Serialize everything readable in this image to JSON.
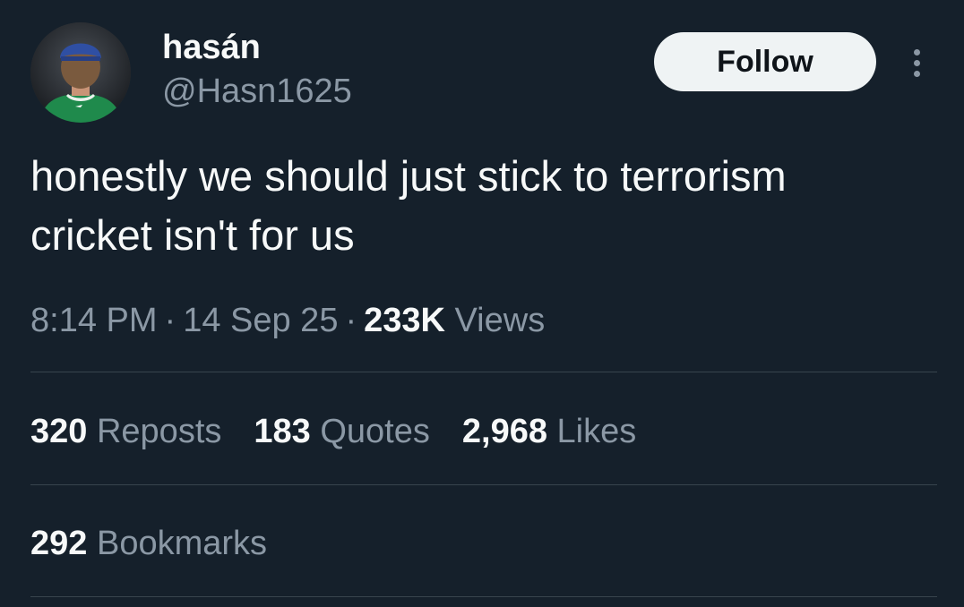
{
  "author": {
    "display_name": "hasán",
    "handle": "@Hasn1625"
  },
  "header": {
    "follow_label": "Follow",
    "more_icon": "more-vertical-icon"
  },
  "tweet": {
    "text_lines": [
      "honestly we should just stick to terrorism",
      "cricket isn't for us"
    ],
    "time": "8:14 PM",
    "date": "14 Sep 25",
    "separator": "·",
    "views_count": "233K",
    "views_label": "Views"
  },
  "stats": {
    "reposts_count": "320",
    "reposts_label": "Reposts",
    "quotes_count": "183",
    "quotes_label": "Quotes",
    "likes_count": "2,968",
    "likes_label": "Likes",
    "bookmarks_count": "292",
    "bookmarks_label": "Bookmarks"
  },
  "colors": {
    "background": "#15202b",
    "primary_text": "#f7f9f9",
    "secondary_text": "#8b98a5",
    "divider": "#38444d",
    "follow_button_bg": "#eff3f4"
  }
}
